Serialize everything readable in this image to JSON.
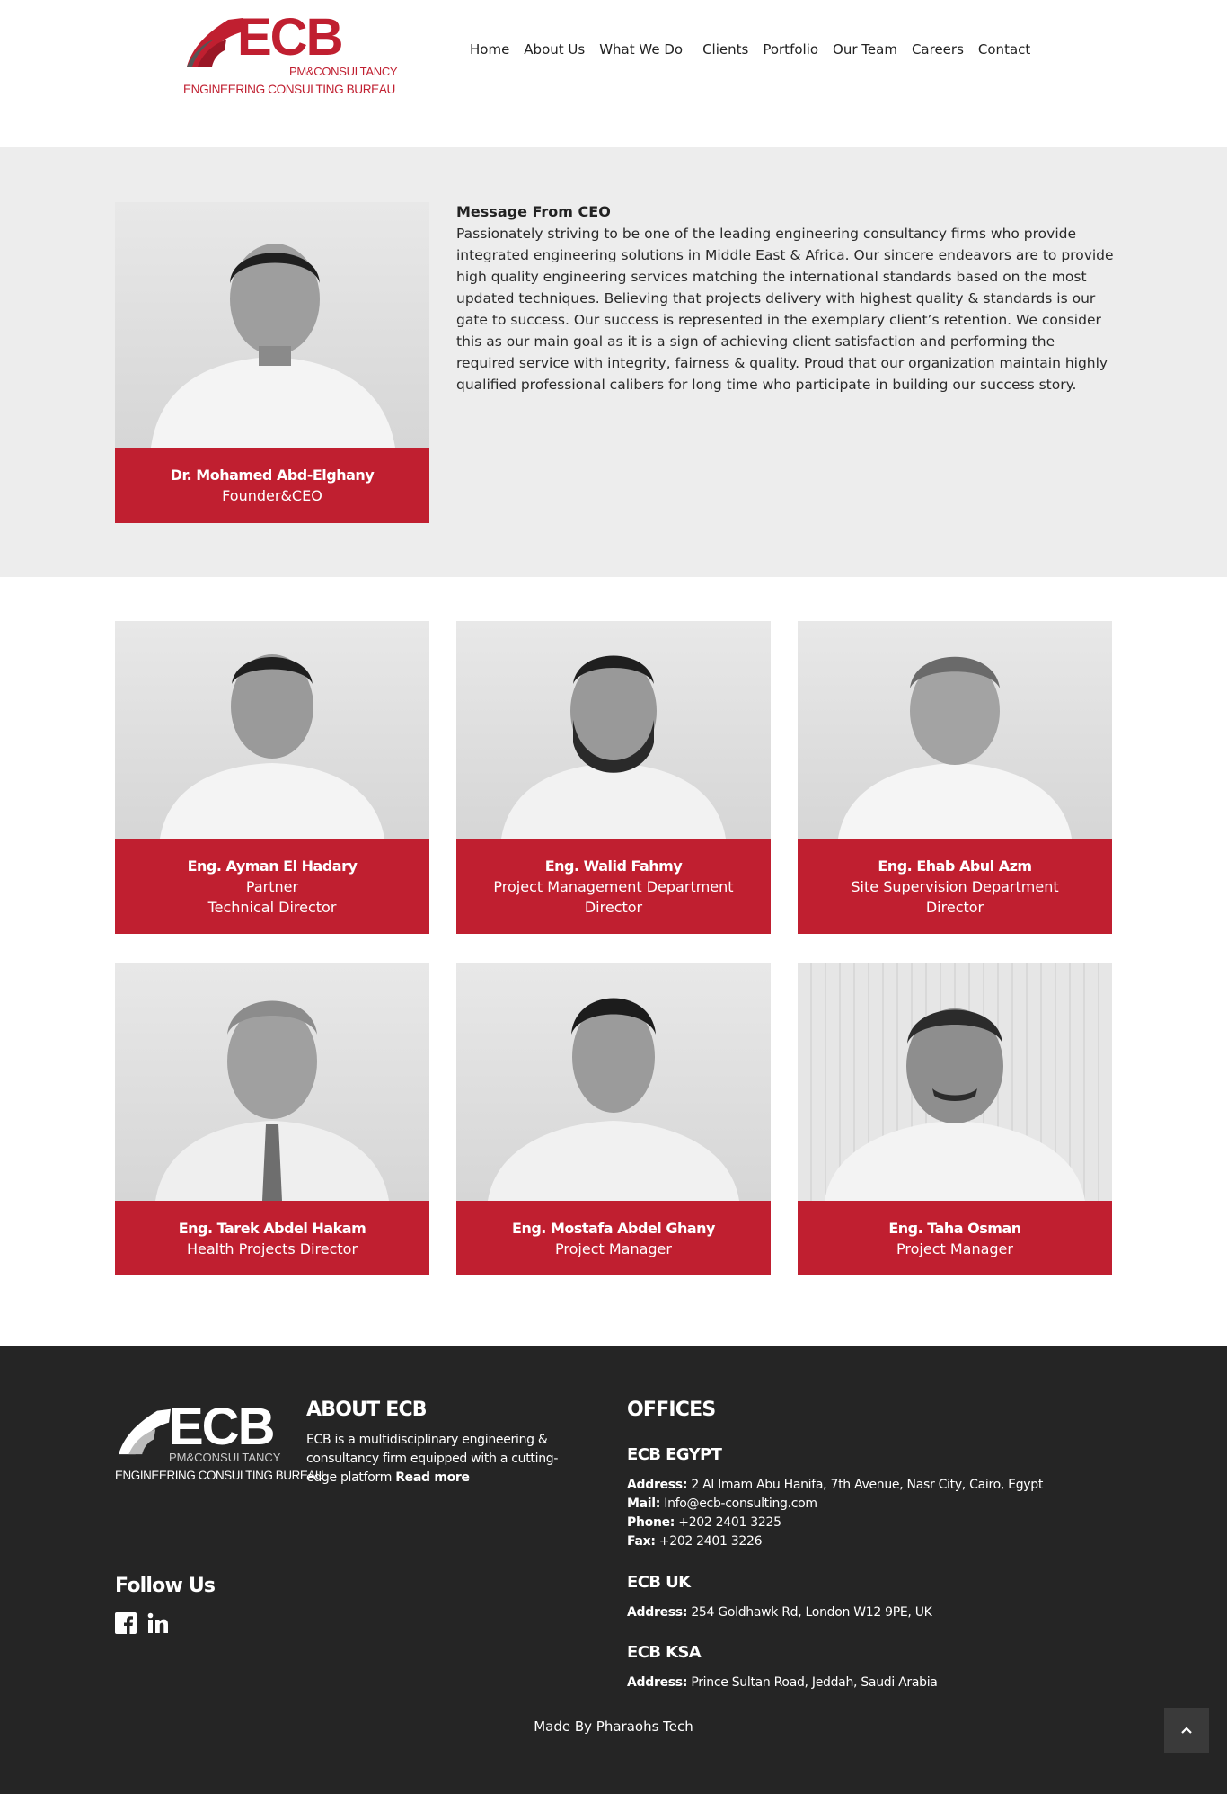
{
  "brand": {
    "name": "ECB",
    "sub": "PM&CONSULTANCY",
    "line": "ENGINEERING CONSULTING BUREAU",
    "color": "#c01f30"
  },
  "nav": {
    "items": [
      "Home",
      "About Us",
      "What We Do",
      "Clients",
      "Portfolio",
      "Our Team",
      "Careers",
      "Contact"
    ]
  },
  "ceo": {
    "name": "Dr. Mohamed Abd-Elghany",
    "role": "Founder&CEO",
    "heading": "Message From CEO",
    "message": "Passionately striving to be one of the leading engineering consultancy firms who provide integrated engineering solutions in Middle East & Africa. Our sincere endeavors are to provide high quality engineering services matching the international standards based on the most updated techniques. Believing that projects delivery with highest quality & standards is our gate to success. Our success is represented in the exemplary client’s retention. We consider this as our main goal as it is a sign of achieving client satisfaction and performing the required service with integrity, fairness & quality. Proud that our organization maintain highly qualified professional calibers for long time who participate in building our success story."
  },
  "team": [
    {
      "name": "Eng. Ayman El Hadary",
      "role1": "Partner",
      "role2": "Technical Director"
    },
    {
      "name": "Eng. Walid Fahmy",
      "role1": "Project Management Department",
      "role2": "Director"
    },
    {
      "name": "Eng. Ehab Abul Azm",
      "role1": "Site Supervision Department",
      "role2": "Director"
    },
    {
      "name": "Eng. Tarek Abdel Hakam",
      "role1": "Health Projects Director",
      "role2": ""
    },
    {
      "name": "Eng. Mostafa Abdel Ghany",
      "role1": "Project Manager",
      "role2": ""
    },
    {
      "name": "Eng. Taha Osman",
      "role1": "Project Manager",
      "role2": ""
    }
  ],
  "footer": {
    "about_title": "ABOUT ECB",
    "about_text": "ECB is a multidisciplinary engineering & consultancy firm equipped with a cutting-edge platform",
    "read_more": "Read more",
    "follow_title": "Follow Us",
    "social_icons": [
      "facebook-icon",
      "linkedin-icon"
    ],
    "offices_title": "OFFICES",
    "offices": {
      "egypt": {
        "title": "ECB EGYPT",
        "address_label": "Address:",
        "address": "2 Al Imam Abu Hanifa, 7th Avenue, Nasr City, Cairo, Egypt",
        "mail_label": "Mail:",
        "mail": "Info@ecb-consulting.com",
        "phone_label": "Phone:",
        "phone": "+202 2401 3225",
        "fax_label": "Fax:",
        "fax": "+202 2401 3226"
      },
      "uk": {
        "title": "ECB UK",
        "address_label": "Address:",
        "address": "254 Goldhawk Rd, London W12 9PE, UK"
      },
      "ksa": {
        "title": "ECB KSA",
        "address_label": "Address:",
        "address": "Prince Sultan Road, Jeddah, Saudi Arabia"
      }
    },
    "made_by": "Made By Pharaohs Tech",
    "back_to_top_icon": "chevron-up-icon"
  }
}
